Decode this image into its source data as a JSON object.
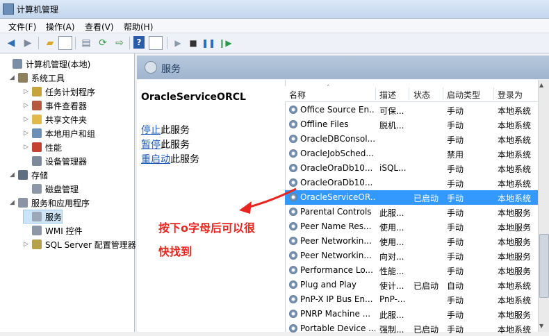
{
  "window": {
    "title": "计算机管理"
  },
  "menu": [
    "文件(F)",
    "操作(A)",
    "查看(V)",
    "帮助(H)"
  ],
  "tree": [
    {
      "label": "计算机管理(本地)",
      "level": 0,
      "expand": "",
      "icon": "computer-icon",
      "color": "#7a8ea8"
    },
    {
      "label": "系统工具",
      "level": 1,
      "expand": "▲",
      "icon": "tools-icon",
      "color": "#8d7f5a"
    },
    {
      "label": "任务计划程序",
      "level": 2,
      "expand": "▷",
      "icon": "clock-icon",
      "color": "#c7a33b"
    },
    {
      "label": "事件查看器",
      "level": 2,
      "expand": "▷",
      "icon": "event-viewer-icon",
      "color": "#b55a3e"
    },
    {
      "label": "共享文件夹",
      "level": 2,
      "expand": "▷",
      "icon": "shared-folder-icon",
      "color": "#e0b94a"
    },
    {
      "label": "本地用户和组",
      "level": 2,
      "expand": "▷",
      "icon": "users-icon",
      "color": "#6c8fb8"
    },
    {
      "label": "性能",
      "level": 2,
      "expand": "▷",
      "icon": "performance-icon",
      "color": "#c4412f"
    },
    {
      "label": "设备管理器",
      "level": 2,
      "expand": "",
      "icon": "device-manager-icon",
      "color": "#7d8a99"
    },
    {
      "label": "存储",
      "level": 1,
      "expand": "▲",
      "icon": "storage-icon",
      "color": "#5f6e80"
    },
    {
      "label": "磁盘管理",
      "level": 2,
      "expand": "",
      "icon": "disk-icon",
      "color": "#8c98a6"
    },
    {
      "label": "服务和应用程序",
      "level": 1,
      "expand": "▲",
      "icon": "services-apps-icon",
      "color": "#8a94a2"
    },
    {
      "label": "服务",
      "level": 2,
      "expand": "",
      "icon": "gear-icon",
      "color": "#9aa8b8",
      "selected": true
    },
    {
      "label": "WMI 控件",
      "level": 2,
      "expand": "",
      "icon": "wmi-icon",
      "color": "#8c98a6"
    },
    {
      "label": "SQL Server 配置管理器",
      "level": 2,
      "expand": "▷",
      "icon": "sql-server-icon",
      "color": "#b7a04c"
    }
  ],
  "panel": {
    "title": "服务"
  },
  "detail": {
    "service_name": "OracleServiceORCL",
    "actions": [
      {
        "link": "停止",
        "rest": "此服务"
      },
      {
        "link": "暂停",
        "rest": "此服务"
      },
      {
        "link": "重启动",
        "rest": "此服务"
      }
    ]
  },
  "annotation": {
    "lines": [
      "按下o字母后可以很",
      "快找到"
    ],
    "color": "#e8251f"
  },
  "columns": [
    "名称",
    "描述",
    "状态",
    "启动类型",
    "登录为"
  ],
  "rows": [
    {
      "name": "Office Source En...",
      "desc": "可保...",
      "status": "",
      "startup": "手动",
      "logon": "本地系统"
    },
    {
      "name": "Offline Files",
      "desc": "脱机...",
      "status": "",
      "startup": "手动",
      "logon": "本地系统"
    },
    {
      "name": "OracleDBConsol...",
      "desc": "",
      "status": "",
      "startup": "手动",
      "logon": "本地系统"
    },
    {
      "name": "OracleJobSched...",
      "desc": "",
      "status": "",
      "startup": "禁用",
      "logon": "本地系统"
    },
    {
      "name": "OracleOraDb10...",
      "desc": "iSQL...",
      "status": "",
      "startup": "手动",
      "logon": "本地系统"
    },
    {
      "name": "OracleOraDb10...",
      "desc": "",
      "status": "",
      "startup": "手动",
      "logon": "本地系统"
    },
    {
      "name": "OracleServiceOR...",
      "desc": "",
      "status": "已启动",
      "startup": "手动",
      "logon": "本地系统",
      "selected": true
    },
    {
      "name": "Parental Controls",
      "desc": "此服...",
      "status": "",
      "startup": "手动",
      "logon": "本地服务"
    },
    {
      "name": "Peer Name Res...",
      "desc": "使用...",
      "status": "",
      "startup": "手动",
      "logon": "本地服务"
    },
    {
      "name": "Peer Networkin...",
      "desc": "使用...",
      "status": "",
      "startup": "手动",
      "logon": "本地服务"
    },
    {
      "name": "Peer Networkin...",
      "desc": "向对...",
      "status": "",
      "startup": "手动",
      "logon": "本地服务"
    },
    {
      "name": "Performance Lo...",
      "desc": "性能...",
      "status": "",
      "startup": "手动",
      "logon": "本地服务"
    },
    {
      "name": "Plug and Play",
      "desc": "使计...",
      "status": "已启动",
      "startup": "自动",
      "logon": "本地系统"
    },
    {
      "name": "PnP-X IP Bus En...",
      "desc": "PnP-...",
      "status": "",
      "startup": "手动",
      "logon": "本地系统"
    },
    {
      "name": "PNRP Machine ...",
      "desc": "此服...",
      "status": "",
      "startup": "手动",
      "logon": "本地服务"
    },
    {
      "name": "Portable Device ...",
      "desc": "强制...",
      "status": "已启动",
      "startup": "手动",
      "logon": "本地系统"
    }
  ],
  "colors": {
    "selection": "#3399ff",
    "link": "#1a5bb8",
    "header": "#b6c8dc"
  }
}
